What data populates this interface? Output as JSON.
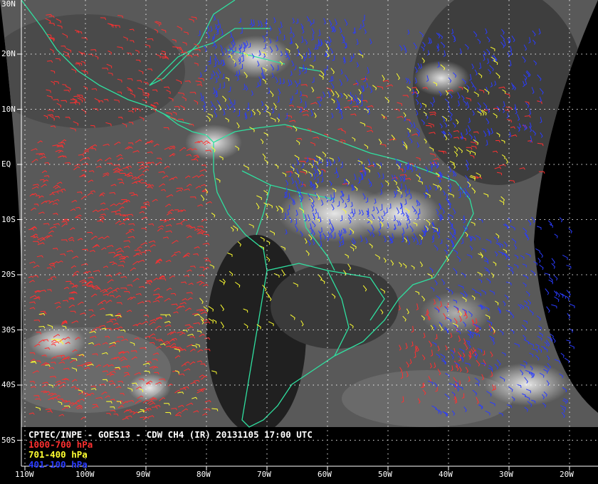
{
  "map": {
    "title": "CPTEC/INPE - GOES13 - CDW CH4 (IR) 20131105 17:00 UTC",
    "lat_labels": [
      "30N",
      "20N",
      "10N",
      "EQ",
      "10S",
      "20S",
      "30S",
      "40S",
      "50S"
    ],
    "lat_values": [
      30,
      20,
      10,
      0,
      -10,
      -20,
      -30,
      -40,
      -50
    ],
    "lon_labels": [
      "110W",
      "100W",
      "90W",
      "80W",
      "70W",
      "60W",
      "50W",
      "40W",
      "30W",
      "20W"
    ],
    "lon_values": [
      -110,
      -100,
      -90,
      -80,
      -70,
      -60,
      -50,
      -40,
      -30,
      -20
    ],
    "legend": [
      {
        "label": "1000-700 hPa",
        "color": "#ff3030"
      },
      {
        "label": "701-400 hPa",
        "color": "#ffff30"
      },
      {
        "label": "401-100 hPa",
        "color": "#2a3cff"
      }
    ],
    "colors": {
      "coastline": "#2fe0a0",
      "grid": "#ffffff",
      "background": "#000000",
      "satellite_gray": "#5a5a5a"
    },
    "extent": {
      "lon_min": -111,
      "lon_max": -16,
      "lat_min": -55,
      "lat_max": 30
    }
  }
}
